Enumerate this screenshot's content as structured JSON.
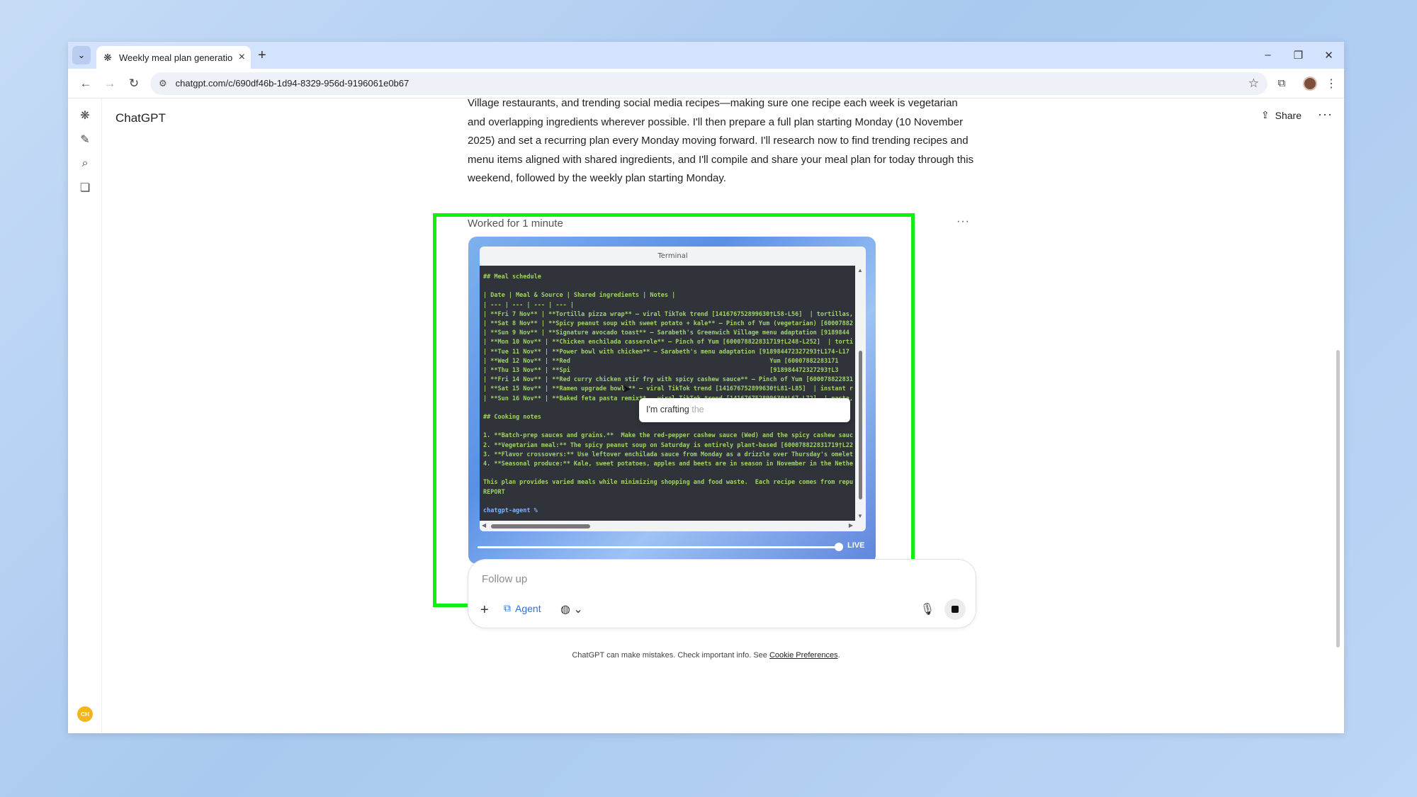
{
  "browser": {
    "tab_title": "Weekly meal plan generation",
    "url": "chatgpt.com/c/690df46b-1d94-8329-956d-9196061e0b67"
  },
  "app": {
    "brand": "ChatGPT",
    "share_label": "Share",
    "avatar_initials": "CH"
  },
  "message": {
    "paragraph": "Village restaurants, and trending social media recipes—making sure one recipe each week is vegetarian and overlapping ingredients wherever possible. I'll then prepare a full plan starting Monday (10 November 2025) and set a recurring plan every Monday moving forward. I'll research now to find trending recipes and menu items aligned with shared ingredients, and I'll compile and share your meal plan for today through this weekend, followed by the weekly plan starting Monday.",
    "worked_label": "Worked for 1 minute"
  },
  "terminal": {
    "title": "Terminal",
    "lines": [
      "## Meal schedule",
      "",
      "| Date | Meal & Source | Shared ingredients | Notes |",
      "| --- | --- | --- | --- |",
      "| **Fri 7 Nov** | **Tortilla pizza wrap** – viral TikTok trend [141676752899630†L58-L56]  | tortillas,",
      "| **Sat 8 Nov** | **Spicy peanut soup with sweet potato + kale** – Pinch of Yum (vegetarian) [60007882",
      "| **Sun 9 Nov** | **Signature avocado toast** – Sarabeth's Greenwich Village menu adaptation [9189844",
      "| **Mon 10 Nov** | **Chicken enchilada casserole** – Pinch of Yum [600078822831719†L248-L252]  | torti",
      "| **Tue 11 Nov** | **Power bowl with chicken** – Sarabeth's menu adaptation [918984472327293†L174-L17",
      "| **Wed 12 Nov** | **Red                                                       Yum [60007882283171",
      "| **Thu 13 Nov** | **Spi                                                       [918984472327293†L3",
      "| **Fri 14 Nov** | **Red curry chicken stir fry with spicy cashew sauce** – Pinch of Yum [600078822831",
      "| **Sat 15 Nov** | **Ramen upgrade bowls** – viral TikTok trend [141676752899630†L81-L85]  | instant r",
      "| **Sun 16 Nov** | **Baked feta pasta remix** – viral TikTok trend [141676752899630†L67-L72]  | pasta,",
      "",
      "## Cooking notes",
      "",
      "1. **Batch-prep sauces and grains.**  Make the red-pepper cashew sauce (Wed) and the spicy cashew sauc",
      "2. **Vegetarian meal:** The spicy peanut soup on Saturday is entirely plant-based [600078822831719†L22",
      "3. **Flavor crossovers:** Use leftover enchilada sauce from Monday as a drizzle over Thursday's omelet",
      "4. **Seasonal produce:** Kale, sweet potatoes, apples and beets are in season in November in the Nethe",
      "",
      "This plan provides varied meals while minimizing shopping and food waste.  Each recipe comes from repu",
      "REPORT",
      "",
      "chatgpt-agent %"
    ],
    "tooltip_text": "I'm crafting",
    "tooltip_fade": "the",
    "live_label": "LIVE"
  },
  "composer": {
    "placeholder": "Follow up",
    "agent_label": "Agent"
  },
  "footer": {
    "disclaimer": "ChatGPT can make mistakes. Check important info. See",
    "link": "Cookie Preferences",
    "period": "."
  }
}
